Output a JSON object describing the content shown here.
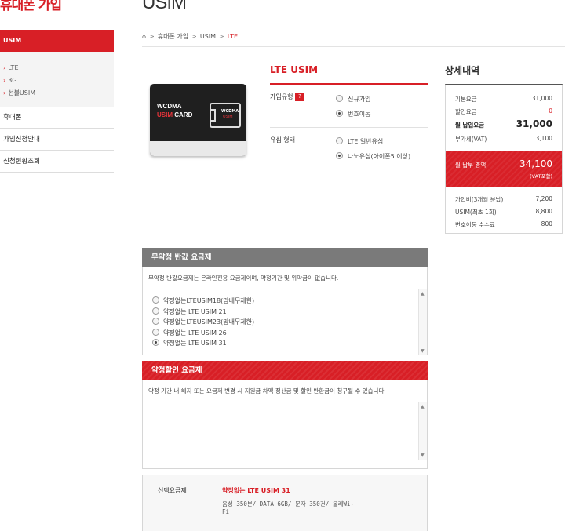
{
  "brand": "휴대폰 가입",
  "sidebar": {
    "active": "USIM",
    "sub_items": [
      "LTE",
      "3G",
      "선불USIM"
    ],
    "links": [
      "휴대폰",
      "가입신청안내",
      "신청현황조회"
    ]
  },
  "page_title": "USIM",
  "breadcrumb": [
    "휴대폰 가입",
    "USIM",
    "LTE"
  ],
  "card": {
    "line1": "WCDMA",
    "line2a": "USIM",
    "line2b": "CARD",
    "chip1": "WCDMA",
    "chip2": "USIM"
  },
  "product": {
    "title": "LTE USIM",
    "join_type_label": "가입유형",
    "join_type_help": "?",
    "join_options": [
      {
        "label": "신규가입",
        "selected": false
      },
      {
        "label": "번호이동",
        "selected": true
      }
    ],
    "sim_type_label": "유심 형태",
    "sim_options": [
      {
        "label": "LTE 일반유심",
        "selected": false
      },
      {
        "label": "나노유심(아이폰5 이상)",
        "selected": true
      }
    ]
  },
  "detail": {
    "title": "상세내역",
    "rows": [
      {
        "label": "기본요금",
        "value": "31,000"
      },
      {
        "label": "할인요금",
        "value": "0"
      },
      {
        "label": "월 납입요금",
        "value": "31,000"
      },
      {
        "label": "부가세(VAT)",
        "value": "3,100"
      }
    ],
    "total_label": "월 납부 총액",
    "total_value": "34,100",
    "total_note": "(VAT포함)",
    "extra_rows": [
      {
        "label": "가입비(3개월 분납)",
        "value": "7,200"
      },
      {
        "label": "USIM(최초 1회)",
        "value": "8,800"
      },
      {
        "label": "번호이동 수수료",
        "value": "800"
      }
    ]
  },
  "free_plans": {
    "title": "무약정 반값 요금제",
    "note": "무약정 반값요금제는 온라인전용 요금제이며, 약정기간 및 위약금이 없습니다.",
    "items": [
      {
        "label": "약정없는LTEUSIM18(망내무제한)",
        "selected": false
      },
      {
        "label": "약정없는 LTE USIM 21",
        "selected": false
      },
      {
        "label": "약정없는LTEUSIM23(망내무제한)",
        "selected": false
      },
      {
        "label": "약정없는 LTE USIM 26",
        "selected": false
      },
      {
        "label": "약정없는 LTE USIM 31",
        "selected": true
      }
    ]
  },
  "discount_plans": {
    "title": "약정할인 요금제",
    "note": "약정 기간 내 해지 또는 요금제 변경 시 지원금 차액 정산금 및 할인 반환금이 청구될 수 있습니다."
  },
  "selected": {
    "label": "선택요금제",
    "name": "약정없는 LTE USIM 31",
    "desc": "음성 350분/ DATA 6GB/ 문자 350건/ 올레Wi-Fi"
  },
  "colors": {
    "accent": "#d81f26",
    "panel_gray": "#7a7a7a"
  }
}
